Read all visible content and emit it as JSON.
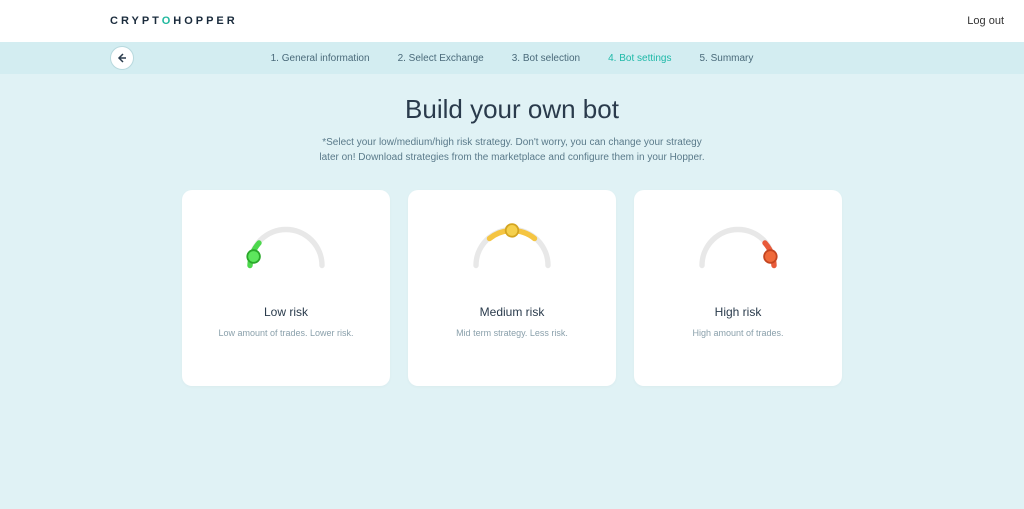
{
  "brand": "CRYPTOHOPPER",
  "logout": "Log out",
  "steps": [
    {
      "label": "1. General information"
    },
    {
      "label": "2. Select Exchange"
    },
    {
      "label": "3. Bot selection"
    },
    {
      "label": "4. Bot settings",
      "active": true
    },
    {
      "label": "5. Summary"
    }
  ],
  "title": "Build your own bot",
  "subtitle": "*Select your low/medium/high risk strategy. Don't worry, you can change your strategy later on! Download strategies from the marketplace and configure them in your Hopper.",
  "cards": [
    {
      "title": "Low risk",
      "desc": "Low amount of trades. Lower risk."
    },
    {
      "title": "Medium risk",
      "desc": "Mid term strategy. Less risk."
    },
    {
      "title": "High risk",
      "desc": "High amount of trades."
    }
  ]
}
